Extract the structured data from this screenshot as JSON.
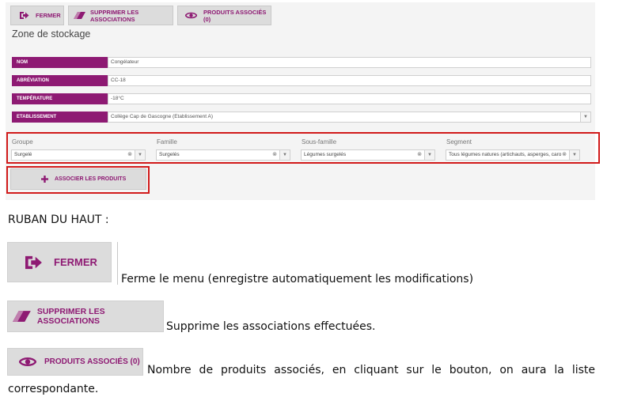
{
  "toolbar": {
    "close_label": "FERMER",
    "delete_assoc_label": "SUPPRIMER LES ASSOCIATIONS",
    "associated_products_label": "PRODUITS ASSOCIÉS (0)"
  },
  "zone_title": "Zone de stockage",
  "fields": [
    {
      "label": "NOM",
      "value": "Congélateur"
    },
    {
      "label": "ABRÉVIATION",
      "value": "CC-18"
    },
    {
      "label": "TEMPÉRATURE",
      "value": "-18°C"
    },
    {
      "label": "ETABLISSEMENT",
      "value": "Collège Cap de Gascogne (Etablissement A)"
    }
  ],
  "filters": [
    {
      "label": "Groupe",
      "value": "Surgelé"
    },
    {
      "label": "Famille",
      "value": "Surgelés"
    },
    {
      "label": "Sous-famille",
      "value": "Légumes surgelés"
    },
    {
      "label": "Segment",
      "value": "Tous légumes natures (artichauts, asperges, caro"
    }
  ],
  "associate_button_label": "ASSOCIER LES PRODUITS",
  "doc": {
    "heading": "RUBAN DU HAUT :",
    "close_desc": "Ferme le menu (enregistre automatiquement les modifications)",
    "delete_desc": "Supprime les associations effectuées.",
    "assoc_desc_line1": "Nombre de produits associés, en cliquant sur le bouton, on aura la liste",
    "assoc_desc_line2": "correspondante."
  },
  "colors": {
    "accent": "#8e1a73",
    "highlight_border": "#d11a1a",
    "button_bg": "#dcdcdc"
  }
}
